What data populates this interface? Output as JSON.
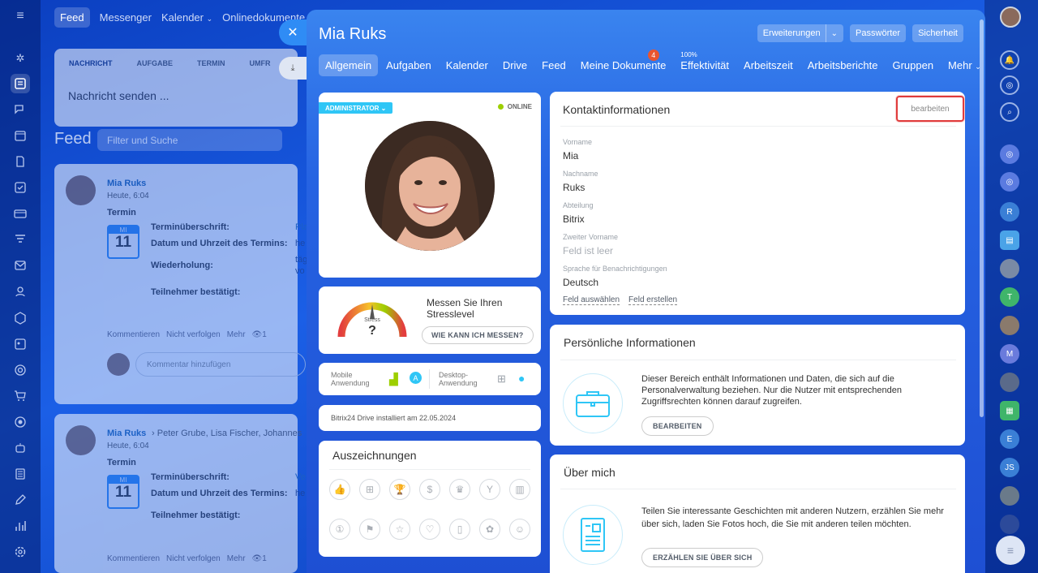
{
  "bg": {
    "nav": [
      "Feed",
      "Messenger",
      "Kalender",
      "Onlinedokumente"
    ],
    "tabs": [
      "NACHRICHT",
      "AUFGABE",
      "TERMIN",
      "UMFR"
    ],
    "message_placeholder": "Nachricht senden ...",
    "feed_title": "Feed",
    "filter_placeholder": "Filter und Suche",
    "post1": {
      "author": "Mia Ruks",
      "time": "Heute, 6:04",
      "type": "Termin",
      "cal_day": "MI",
      "cal_num": "11",
      "row1": "Terminüberschrift:",
      "row2": "Datum und Uhrzeit des Termins:",
      "row3": "Wiederholung:",
      "row4": "Teilnehmer bestätigt:",
      "v1": "Pla",
      "v2": "he",
      "v3": "täg",
      "v3b": "vo",
      "actions": [
        "Kommentieren",
        "Nicht verfolgen",
        "Mehr"
      ],
      "views": "1",
      "comment_placeholder": "Kommentar hinzufügen"
    },
    "post2": {
      "author": "Mia Ruks",
      "recipients": "Peter Grube, Lisa Fischer, Johannes",
      "time": "Heute, 6:04",
      "type": "Termin",
      "cal_day": "MI",
      "cal_num": "11",
      "row1": "Terminüberschrift:",
      "row2": "Datum und Uhrzeit des Termins:",
      "row4": "Teilnehmer bestätigt:",
      "v1": "Ve",
      "v2": "he",
      "actions": [
        "Kommentieren",
        "Nicht verfolgen",
        "Mehr"
      ],
      "views": "1"
    }
  },
  "slider": {
    "title": "Mia Ruks",
    "header_buttons": {
      "extensions": "Erweiterungen",
      "passwords": "Passwörter",
      "security": "Sicherheit"
    },
    "tabs": [
      {
        "label": "Allgemein"
      },
      {
        "label": "Aufgaben"
      },
      {
        "label": "Kalender"
      },
      {
        "label": "Drive"
      },
      {
        "label": "Feed"
      },
      {
        "label": "Meine Dokumente",
        "badge": "4"
      },
      {
        "label": "Effektivität",
        "pct": "100%"
      },
      {
        "label": "Arbeitszeit"
      },
      {
        "label": "Arbeitsberichte"
      },
      {
        "label": "Gruppen"
      },
      {
        "label": "Mehr"
      }
    ]
  },
  "profile": {
    "role": "ADMINISTRATOR",
    "status": "ONLINE"
  },
  "stress": {
    "gauge_label": "Stress",
    "gauge_value": "?",
    "text": "Messen Sie Ihren Stresslevel",
    "button": "WIE KANN ICH MESSEN?"
  },
  "apps": {
    "mobile": "Mobile Anwendung",
    "desktop": "Desktop-Anwendung"
  },
  "drive": "Bitrix24 Drive installiert am 22.05.2024",
  "awards": {
    "title": "Auszeichnungen"
  },
  "contact": {
    "title": "Kontaktinformationen",
    "edit": "bearbeiten",
    "fields": [
      {
        "label": "Vorname",
        "value": "Mia"
      },
      {
        "label": "Nachname",
        "value": "Ruks"
      },
      {
        "label": "Abteilung",
        "value": "Bitrix"
      },
      {
        "label": "Zweiter Vorname",
        "value": "Feld ist leer"
      },
      {
        "label": "Sprache für Benachrichtigungen",
        "value": "Deutsch"
      }
    ],
    "select_field": "Feld auswählen",
    "create_field": "Feld erstellen"
  },
  "personal": {
    "title": "Persönliche Informationen",
    "text": "Dieser Bereich enthält Informationen und Daten, die sich auf die Personalverwaltung beziehen. Nur die Nutzer mit entsprechenden Zugriffsrechten können darauf zugreifen.",
    "button": "BEARBEITEN"
  },
  "about": {
    "title": "Über mich",
    "text": "Teilen Sie interessante Geschichten mit anderen Nutzern, erzählen Sie mehr über sich, laden Sie Fotos hoch, die Sie mit anderen teilen möchten.",
    "button": "ERZÄHLEN SIE ÜBER SICH"
  },
  "rrail": {
    "av1": "R",
    "av2": "T",
    "av3": "M",
    "av4": "E",
    "av5": "JS"
  },
  "colors": {
    "accent": "#2fc6f6",
    "online": "#9dcf00",
    "badge": "#e9552f",
    "highlight": "#e03c3c"
  }
}
